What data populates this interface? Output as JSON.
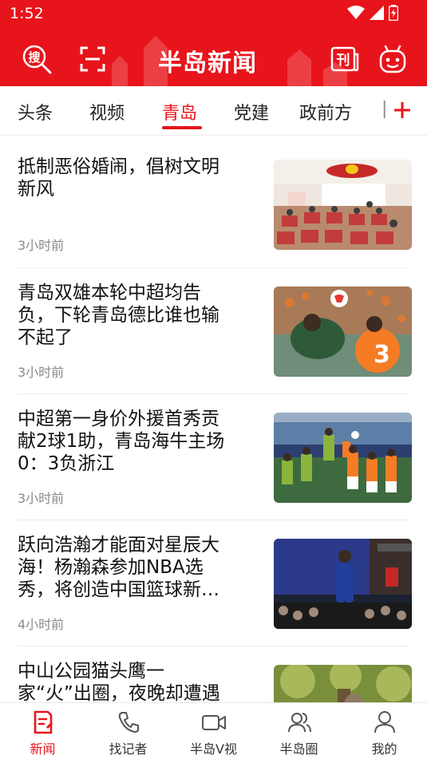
{
  "status_bar": {
    "time": "1:52"
  },
  "header": {
    "brand": "半岛新闻",
    "search_icon_char": "搜",
    "epaper_icon_char": "刊"
  },
  "tabs": [
    {
      "label": "头条",
      "active": false
    },
    {
      "label": "视频",
      "active": false
    },
    {
      "label": "青岛",
      "active": true
    },
    {
      "label": "党建",
      "active": false
    },
    {
      "label": "政前方",
      "active": false
    },
    {
      "label": "|",
      "active": false
    }
  ],
  "news": [
    {
      "title": "抵制恶俗婚闹，倡树文明新风",
      "time": "3小时前",
      "thumb": "meeting-room-photo"
    },
    {
      "title": "青岛双雄本轮中超均告负，下轮青岛德比谁也输不起了",
      "time": "3小时前",
      "thumb": "soccer-header-photo"
    },
    {
      "title": "中超第一身价外援首秀贡献2球1助，青岛海牛主场0：3负浙江",
      "time": "3小时前",
      "thumb": "soccer-match-photo"
    },
    {
      "title": "跃向浩瀚才能面对星辰大海！杨瀚森参加NBA选秀，将创造中国篮球新…",
      "time": "4小时前",
      "thumb": "nba-draft-photo"
    },
    {
      "title": "中山公园猫头鹰一家“火”出圈，夜晚却遭遇",
      "time": "",
      "thumb": "owl-tree-photo"
    }
  ],
  "bottom_nav": [
    {
      "label": "新闻",
      "icon": "news-icon",
      "active": true
    },
    {
      "label": "找记者",
      "icon": "phone-icon",
      "active": false
    },
    {
      "label": "半岛V视",
      "icon": "video-icon",
      "active": false
    },
    {
      "label": "半岛圈",
      "icon": "people-icon",
      "active": false
    },
    {
      "label": "我的",
      "icon": "profile-icon",
      "active": false
    }
  ],
  "colors": {
    "brand_red": "#e8141b",
    "text": "#111111",
    "muted": "#8a8a8a"
  }
}
